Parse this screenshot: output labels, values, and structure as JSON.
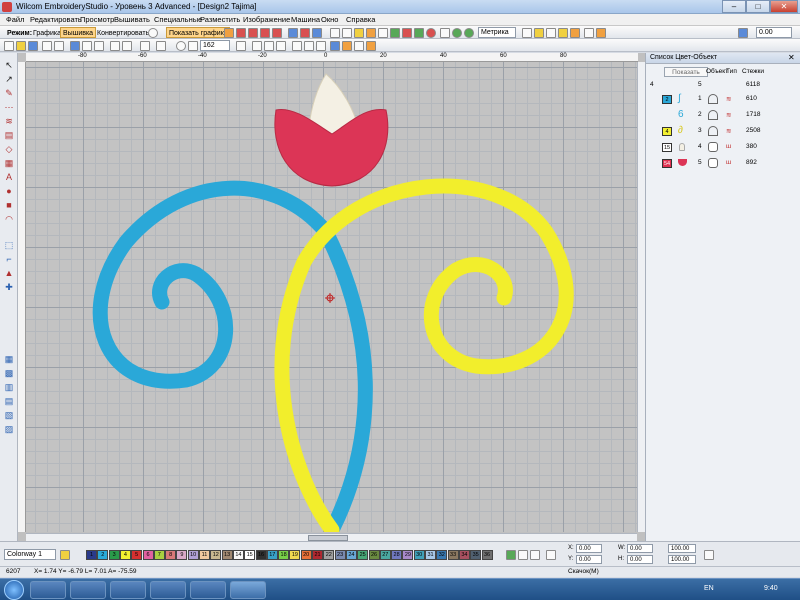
{
  "title": "Wilcom EmbroideryStudio - Уровень 3 Advanced - [Design2 Tajima]",
  "menu": [
    "Файл",
    "Редактировать",
    "Просмотр",
    "Вышивать",
    "Специальные",
    "Разместить",
    "Изображение",
    "Машина",
    "Окно",
    "Справка"
  ],
  "toolbar1": {
    "mode_label": "Режим:",
    "graphics": "Графика",
    "embroidery": "Вышивка",
    "convert": "Конвертировать",
    "show_graphics": "Показать графику",
    "zoom_value": "162",
    "units": "Метрика",
    "angle_value": "0.00"
  },
  "panel": {
    "title": "Список Цвет-Объект",
    "show_button": "Показать",
    "col_obj": "Объект",
    "col_type": "Тип",
    "col_stitches": "Стежки",
    "rows": [
      {
        "num": "4",
        "obj": "5",
        "stitches": "6118",
        "color": "",
        "swatch": ""
      },
      {
        "num": "",
        "obj": "1",
        "stitches": "610",
        "color": "#2aa8d8",
        "swatch": "2"
      },
      {
        "num": "",
        "obj": "2",
        "stitches": "1718",
        "color": "",
        "swatch": ""
      },
      {
        "num": "",
        "obj": "3",
        "stitches": "2508",
        "color": "#f2f030",
        "swatch": "4"
      },
      {
        "num": "",
        "obj": "4",
        "stitches": "380",
        "color": "#ffffff",
        "swatch": "15"
      },
      {
        "num": "",
        "obj": "5",
        "stitches": "892",
        "color": "#e03050",
        "swatch": "54"
      }
    ]
  },
  "colorway": {
    "name": "Colorway 1",
    "swatches": [
      {
        "n": "1",
        "c": "#2a3a8a"
      },
      {
        "n": "2",
        "c": "#2aa8d8"
      },
      {
        "n": "3",
        "c": "#2a9a4a"
      },
      {
        "n": "4",
        "c": "#f2f030"
      },
      {
        "n": "5",
        "c": "#d83030"
      },
      {
        "n": "6",
        "c": "#e060a0"
      },
      {
        "n": "7",
        "c": "#a8d040"
      },
      {
        "n": "8",
        "c": "#d87878"
      },
      {
        "n": "9",
        "c": "#d8a8c8"
      },
      {
        "n": "10",
        "c": "#b0a0d8"
      },
      {
        "n": "11",
        "c": "#f0c8a0"
      },
      {
        "n": "12",
        "c": "#c8b890"
      },
      {
        "n": "13",
        "c": "#a08870"
      },
      {
        "n": "14",
        "c": "#f8f8f8"
      },
      {
        "n": "15",
        "c": "#ffffff"
      },
      {
        "n": "16",
        "c": "#303030"
      },
      {
        "n": "17",
        "c": "#38a0c8"
      },
      {
        "n": "18",
        "c": "#78d048"
      },
      {
        "n": "19",
        "c": "#f0d850"
      },
      {
        "n": "20",
        "c": "#e87038"
      },
      {
        "n": "21",
        "c": "#b02830"
      },
      {
        "n": "22",
        "c": "#a0a0a0"
      },
      {
        "n": "23",
        "c": "#7a8ab0"
      },
      {
        "n": "24",
        "c": "#68a8d8"
      },
      {
        "n": "25",
        "c": "#48a878"
      },
      {
        "n": "26",
        "c": "#6a8a40"
      },
      {
        "n": "27",
        "c": "#4aa8a0"
      },
      {
        "n": "28",
        "c": "#7078c0"
      },
      {
        "n": "29",
        "c": "#a888c8"
      },
      {
        "n": "30",
        "c": "#40a0b8"
      },
      {
        "n": "31",
        "c": "#a8c8e8"
      },
      {
        "n": "32",
        "c": "#3878b0"
      },
      {
        "n": "33",
        "c": "#8a7860"
      },
      {
        "n": "34",
        "c": "#a85060"
      },
      {
        "n": "35",
        "c": "#506070"
      },
      {
        "n": "36",
        "c": "#707070"
      }
    ]
  },
  "coords": {
    "x_label": "X:",
    "x_value": "0.00",
    "y_label": "Y:",
    "y_value": "0.00",
    "w_label": "W:",
    "w_value": "0.00",
    "h_label": "H:",
    "h_value": "0.00",
    "sx_value": "100.00",
    "sy_value": "100.00"
  },
  "status": {
    "left": "6207",
    "coords": "X= 1.74 Y= -6.79 L= 7.01 A= -75.59",
    "hint": "Скачок(M)"
  },
  "taskbar": {
    "lang": "EN",
    "time": "9:40"
  },
  "design": {
    "blue": "#2aa8d8",
    "yellow": "#f2ee2c",
    "red": "#dc3556",
    "white": "#f4f0e4"
  }
}
